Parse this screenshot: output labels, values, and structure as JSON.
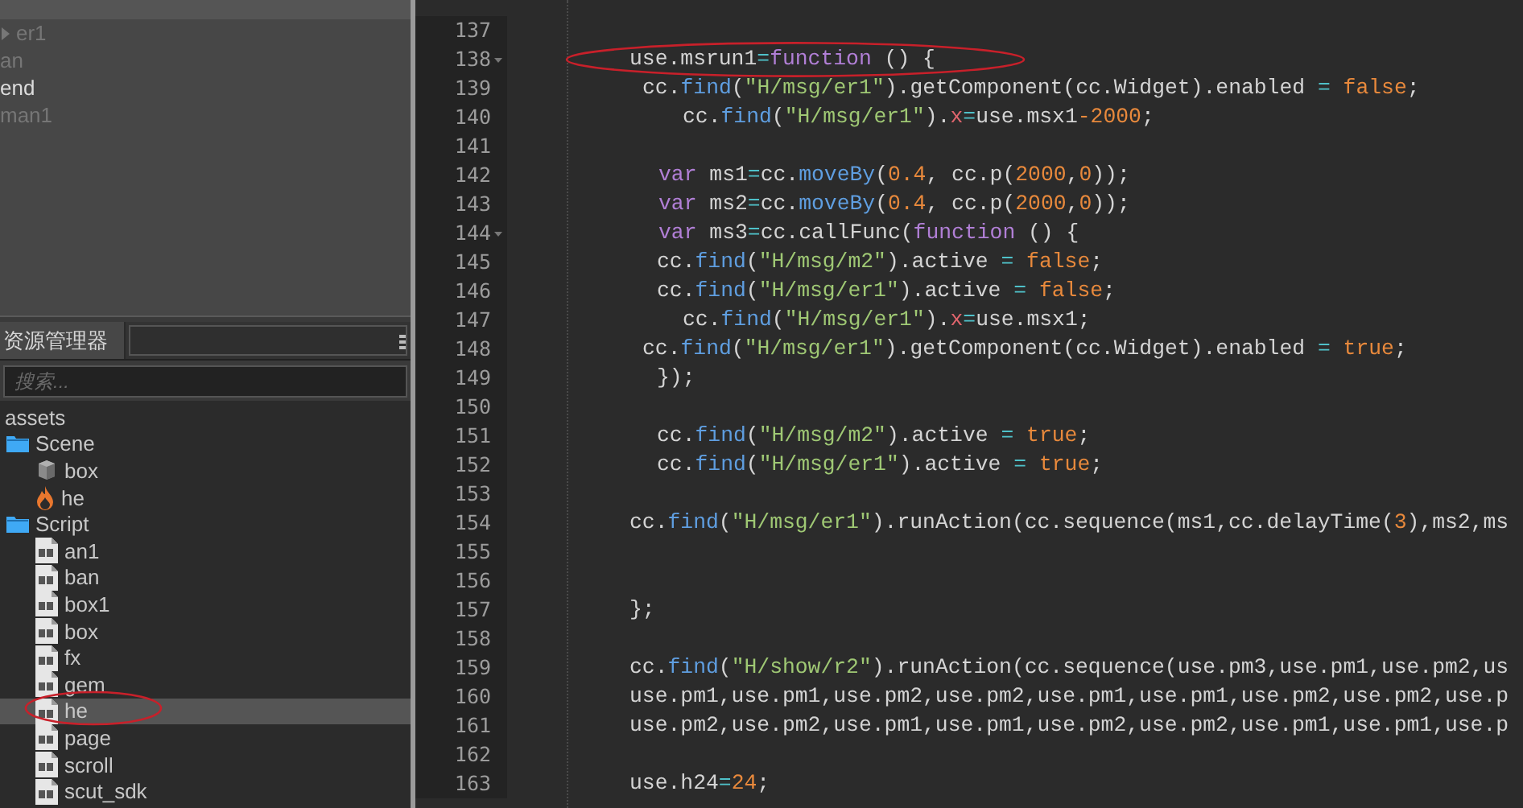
{
  "hierarchy": {
    "rows": [
      {
        "label": "er1",
        "kind": "parent",
        "selected": false,
        "dimmed": true
      },
      {
        "label": "an",
        "kind": "leaf",
        "selected": false,
        "dimmed": true
      },
      {
        "label": "end",
        "kind": "leaf",
        "selected": false,
        "dimmed": false
      },
      {
        "label": "man1",
        "kind": "leaf",
        "selected": false,
        "dimmed": true
      }
    ]
  },
  "assets_panel": {
    "tabs": [
      {
        "label": "资源管理器",
        "selected": true
      }
    ],
    "search": {
      "placeholder": "搜索..."
    },
    "tree": [
      {
        "label": "assets",
        "selected": false,
        "children": [
          {
            "label": "Scene",
            "kind": "folder",
            "selected": false,
            "children": [
              {
                "label": "box",
                "kind": "prefab",
                "selected": false
              },
              {
                "label": "he",
                "kind": "scene",
                "selected": false
              }
            ]
          },
          {
            "label": "Script",
            "kind": "folder",
            "selected": false,
            "children": [
              {
                "label": "an1",
                "kind": "script",
                "selected": false
              },
              {
                "label": "ban",
                "kind": "script",
                "selected": false
              },
              {
                "label": "box1",
                "kind": "script",
                "selected": false
              },
              {
                "label": "box",
                "kind": "script",
                "selected": false
              },
              {
                "label": "fx",
                "kind": "script",
                "selected": false
              },
              {
                "label": "gem",
                "kind": "script",
                "selected": false
              },
              {
                "label": "he",
                "kind": "script",
                "selected": true
              },
              {
                "label": "page",
                "kind": "script",
                "selected": false
              },
              {
                "label": "scroll",
                "kind": "script",
                "selected": false
              },
              {
                "label": "scut_sdk",
                "kind": "script",
                "selected": false
              }
            ]
          }
        ]
      }
    ]
  },
  "editor": {
    "lines": [
      {
        "number": "137",
        "fold": false
      },
      {
        "number": "138",
        "fold": true,
        "tokens": [
          {
            "kind": "plain",
            "text": "use.msrun1"
          },
          {
            "kind": "op",
            "text": "="
          },
          {
            "kind": "kw",
            "text": "function"
          },
          {
            "kind": "plain",
            "text": " () {"
          }
        ]
      },
      {
        "number": "139",
        "fold": false,
        "tokens": [
          {
            "kind": "plain",
            "text": "cc."
          },
          {
            "kind": "fn",
            "text": "find"
          },
          {
            "kind": "plain",
            "text": "("
          },
          {
            "kind": "str",
            "text": "\"H/msg/er1\""
          },
          {
            "kind": "plain",
            "text": ").getComponent(cc.Widget).enabled "
          },
          {
            "kind": "op",
            "text": "="
          },
          {
            "kind": "num",
            "text": " false"
          },
          {
            "kind": "plain",
            "text": ";"
          }
        ]
      },
      {
        "number": "140",
        "fold": false,
        "tokens": [
          {
            "kind": "plain",
            "text": "cc."
          },
          {
            "kind": "fn",
            "text": "find"
          },
          {
            "kind": "plain",
            "text": "("
          },
          {
            "kind": "str",
            "text": "\"H/msg/er1\""
          },
          {
            "kind": "plain",
            "text": ")."
          },
          {
            "kind": "prop",
            "text": "x"
          },
          {
            "kind": "op",
            "text": "="
          },
          {
            "kind": "plain",
            "text": "use.msx1"
          },
          {
            "kind": "num",
            "text": "-2000"
          },
          {
            "kind": "plain",
            "text": ";"
          }
        ]
      },
      {
        "number": "141",
        "fold": false
      },
      {
        "number": "142",
        "fold": false,
        "tokens": [
          {
            "kind": "kw",
            "text": "var"
          },
          {
            "kind": "plain",
            "text": " ms1"
          },
          {
            "kind": "op",
            "text": "="
          },
          {
            "kind": "plain",
            "text": "cc."
          },
          {
            "kind": "fn",
            "text": "moveBy"
          },
          {
            "kind": "plain",
            "text": "("
          },
          {
            "kind": "num",
            "text": "0.4"
          },
          {
            "kind": "plain",
            "text": ", cc.p("
          },
          {
            "kind": "num",
            "text": "2000"
          },
          {
            "kind": "plain",
            "text": ","
          },
          {
            "kind": "num",
            "text": "0"
          },
          {
            "kind": "plain",
            "text": "));"
          }
        ]
      },
      {
        "number": "143",
        "fold": false,
        "tokens": [
          {
            "kind": "kw",
            "text": "var"
          },
          {
            "kind": "plain",
            "text": " ms2"
          },
          {
            "kind": "op",
            "text": "="
          },
          {
            "kind": "plain",
            "text": "cc."
          },
          {
            "kind": "fn",
            "text": "moveBy"
          },
          {
            "kind": "plain",
            "text": "("
          },
          {
            "kind": "num",
            "text": "0.4"
          },
          {
            "kind": "plain",
            "text": ", cc.p("
          },
          {
            "kind": "num",
            "text": "2000"
          },
          {
            "kind": "plain",
            "text": ","
          },
          {
            "kind": "num",
            "text": "0"
          },
          {
            "kind": "plain",
            "text": "));"
          }
        ]
      },
      {
        "number": "144",
        "fold": true,
        "tokens": [
          {
            "kind": "kw",
            "text": "var"
          },
          {
            "kind": "plain",
            "text": " ms3"
          },
          {
            "kind": "op",
            "text": "="
          },
          {
            "kind": "plain",
            "text": "cc.callFunc("
          },
          {
            "kind": "kw",
            "text": "function"
          },
          {
            "kind": "plain",
            "text": " () {"
          }
        ]
      },
      {
        "number": "145",
        "fold": false,
        "tokens": [
          {
            "kind": "plain",
            "text": "cc."
          },
          {
            "kind": "fn",
            "text": "find"
          },
          {
            "kind": "plain",
            "text": "("
          },
          {
            "kind": "str",
            "text": "\"H/msg/m2\""
          },
          {
            "kind": "plain",
            "text": ").active "
          },
          {
            "kind": "op",
            "text": "="
          },
          {
            "kind": "num",
            "text": " false"
          },
          {
            "kind": "plain",
            "text": ";"
          }
        ]
      },
      {
        "number": "146",
        "fold": false,
        "tokens": [
          {
            "kind": "plain",
            "text": "cc."
          },
          {
            "kind": "fn",
            "text": "find"
          },
          {
            "kind": "plain",
            "text": "("
          },
          {
            "kind": "str",
            "text": "\"H/msg/er1\""
          },
          {
            "kind": "plain",
            "text": ").active "
          },
          {
            "kind": "op",
            "text": "="
          },
          {
            "kind": "num",
            "text": " false"
          },
          {
            "kind": "plain",
            "text": ";"
          }
        ]
      },
      {
        "number": "147",
        "fold": false,
        "tokens": [
          {
            "kind": "plain",
            "text": "cc."
          },
          {
            "kind": "fn",
            "text": "find"
          },
          {
            "kind": "plain",
            "text": "("
          },
          {
            "kind": "str",
            "text": "\"H/msg/er1\""
          },
          {
            "kind": "plain",
            "text": ")."
          },
          {
            "kind": "prop",
            "text": "x"
          },
          {
            "kind": "op",
            "text": "="
          },
          {
            "kind": "plain",
            "text": "use.msx1;"
          }
        ]
      },
      {
        "number": "148",
        "fold": false,
        "tokens": [
          {
            "kind": "plain",
            "text": "cc."
          },
          {
            "kind": "fn",
            "text": "find"
          },
          {
            "kind": "plain",
            "text": "("
          },
          {
            "kind": "str",
            "text": "\"H/msg/er1\""
          },
          {
            "kind": "plain",
            "text": ").getComponent(cc.Widget).enabled "
          },
          {
            "kind": "op",
            "text": "="
          },
          {
            "kind": "num",
            "text": " true"
          },
          {
            "kind": "plain",
            "text": ";"
          }
        ]
      },
      {
        "number": "149",
        "fold": false,
        "tokens": [
          {
            "kind": "plain",
            "text": "});"
          }
        ]
      },
      {
        "number": "150",
        "fold": false
      },
      {
        "number": "151",
        "fold": false,
        "tokens": [
          {
            "kind": "plain",
            "text": "cc."
          },
          {
            "kind": "fn",
            "text": "find"
          },
          {
            "kind": "plain",
            "text": "("
          },
          {
            "kind": "str",
            "text": "\"H/msg/m2\""
          },
          {
            "kind": "plain",
            "text": ").active "
          },
          {
            "kind": "op",
            "text": "="
          },
          {
            "kind": "num",
            "text": " true"
          },
          {
            "kind": "plain",
            "text": ";"
          }
        ]
      },
      {
        "number": "152",
        "fold": false,
        "tokens": [
          {
            "kind": "plain",
            "text": "cc."
          },
          {
            "kind": "fn",
            "text": "find"
          },
          {
            "kind": "plain",
            "text": "("
          },
          {
            "kind": "str",
            "text": "\"H/msg/er1\""
          },
          {
            "kind": "plain",
            "text": ").active "
          },
          {
            "kind": "op",
            "text": "="
          },
          {
            "kind": "num",
            "text": " true"
          },
          {
            "kind": "plain",
            "text": ";"
          }
        ]
      },
      {
        "number": "153",
        "fold": false
      },
      {
        "number": "154",
        "fold": false,
        "tokens": [
          {
            "kind": "plain",
            "text": "cc."
          },
          {
            "kind": "fn",
            "text": "find"
          },
          {
            "kind": "plain",
            "text": "("
          },
          {
            "kind": "str",
            "text": "\"H/msg/er1\""
          },
          {
            "kind": "plain",
            "text": ").runAction(cc.sequence(ms1,cc.delayTime("
          },
          {
            "kind": "num",
            "text": "3"
          },
          {
            "kind": "plain",
            "text": "),ms2,ms"
          }
        ]
      },
      {
        "number": "155",
        "fold": false
      },
      {
        "number": "156",
        "fold": false
      },
      {
        "number": "157",
        "fold": false,
        "tokens": [
          {
            "kind": "plain",
            "text": "};"
          }
        ]
      },
      {
        "number": "158",
        "fold": false
      },
      {
        "number": "159",
        "fold": false,
        "tokens": [
          {
            "kind": "plain",
            "text": "cc."
          },
          {
            "kind": "fn",
            "text": "find"
          },
          {
            "kind": "plain",
            "text": "("
          },
          {
            "kind": "str",
            "text": "\"H/show/r2\""
          },
          {
            "kind": "plain",
            "text": ").runAction(cc.sequence(use.pm3,use.pm1,use.pm2,us"
          }
        ]
      },
      {
        "number": "160",
        "fold": false,
        "tokens": [
          {
            "kind": "plain",
            "text": "use.pm1,use.pm1,use.pm2,use.pm2,use.pm1,use.pm1,use.pm2,use.pm2,use.p"
          }
        ]
      },
      {
        "number": "161",
        "fold": false,
        "tokens": [
          {
            "kind": "plain",
            "text": "use.pm2,use.pm2,use.pm1,use.pm1,use.pm2,use.pm2,use.pm1,use.pm1,use.p"
          }
        ]
      },
      {
        "number": "162",
        "fold": false
      },
      {
        "number": "163",
        "fold": false,
        "tokens": [
          {
            "kind": "plain",
            "text": "use.h24"
          },
          {
            "kind": "op",
            "text": "="
          },
          {
            "kind": "num",
            "text": "24"
          },
          {
            "kind": "plain",
            "text": ";"
          }
        ]
      }
    ]
  }
}
